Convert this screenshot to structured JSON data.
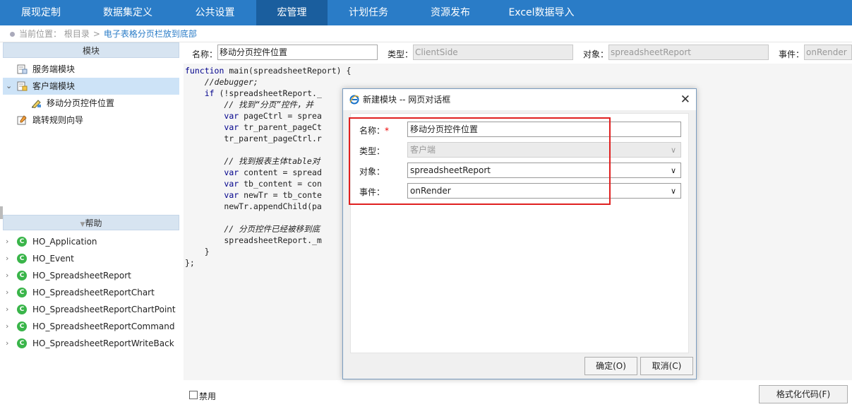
{
  "nav": {
    "tabs": [
      {
        "label": "展现定制",
        "active": false
      },
      {
        "label": "数据集定义",
        "active": false
      },
      {
        "label": "公共设置",
        "active": false
      },
      {
        "label": "宏管理",
        "active": true
      },
      {
        "label": "计划任务",
        "active": false
      },
      {
        "label": "资源发布",
        "active": false
      },
      {
        "label": "Excel数据导入",
        "active": false
      }
    ],
    "colors": {
      "bar": "#2a7cc7",
      "active": "#1a5e9e"
    }
  },
  "breadcrumb": {
    "prefix": "当前位置：",
    "root": "根目录",
    "separator": ">",
    "current": "电子表格分页栏放到底部"
  },
  "modules_panel": {
    "title": "模块",
    "items": [
      {
        "label": "服务端模块",
        "icon": "server-module-icon"
      },
      {
        "label": "客户端模块",
        "icon": "client-module-icon",
        "selected": true
      },
      {
        "label": "移动分页控件位置",
        "icon": "macro-edit-icon"
      },
      {
        "label": "跳转规则向导",
        "icon": "wizard-icon"
      }
    ]
  },
  "help_panel": {
    "title": "帮助",
    "items": [
      "HO_Application",
      "HO_Event",
      "HO_SpreadsheetReport",
      "HO_SpreadsheetReportChart",
      "HO_SpreadsheetReportChartPoint",
      "HO_SpreadsheetReportCommand",
      "HO_SpreadsheetReportWriteBack"
    ],
    "badge": "C"
  },
  "editor_header": {
    "name_label": "名称：",
    "name_value": "移动分页控件位置",
    "type_label": "类型：",
    "type_value": "ClientSide",
    "object_label": "对象：",
    "object_value": "spreadsheetReport",
    "event_label": "事件：",
    "event_value": "onRender"
  },
  "code": {
    "lines": [
      "function main(spreadsheetReport) {",
      "    //debugger;",
      "    if (!spreadsheetReport._",
      "        // 找到“分页”控件，并",
      "        var pageCtrl = sprea",
      "        var tr_parent_pageCt",
      "        tr_parent_pageCtrl.r",
      "",
      "        // 找到报表主体table对",
      "        var content = spread",
      "        var tb_content = con",
      "        var newTr = tb_conte",
      "        newTr.appendChild(pa",
      "",
      "        // 分页控件已经被移到底",
      "        spreadsheetReport._m",
      "    }",
      "};"
    ]
  },
  "bottom": {
    "disable_label": "禁用",
    "format_button": "格式化代码(F)"
  },
  "dialog": {
    "title": "新建模块 -- 网页对话框",
    "name_label": "名称：",
    "required_mark": "*",
    "name_value": "移动分页控件位置",
    "type_label": "类型：",
    "type_value": "客户端",
    "object_label": "对象：",
    "object_value": "spreadsheetReport",
    "event_label": "事件：",
    "event_value": "onRender",
    "ok_button": "确定(O)",
    "cancel_button": "取消(C)",
    "highlight_color": "#e02020"
  }
}
